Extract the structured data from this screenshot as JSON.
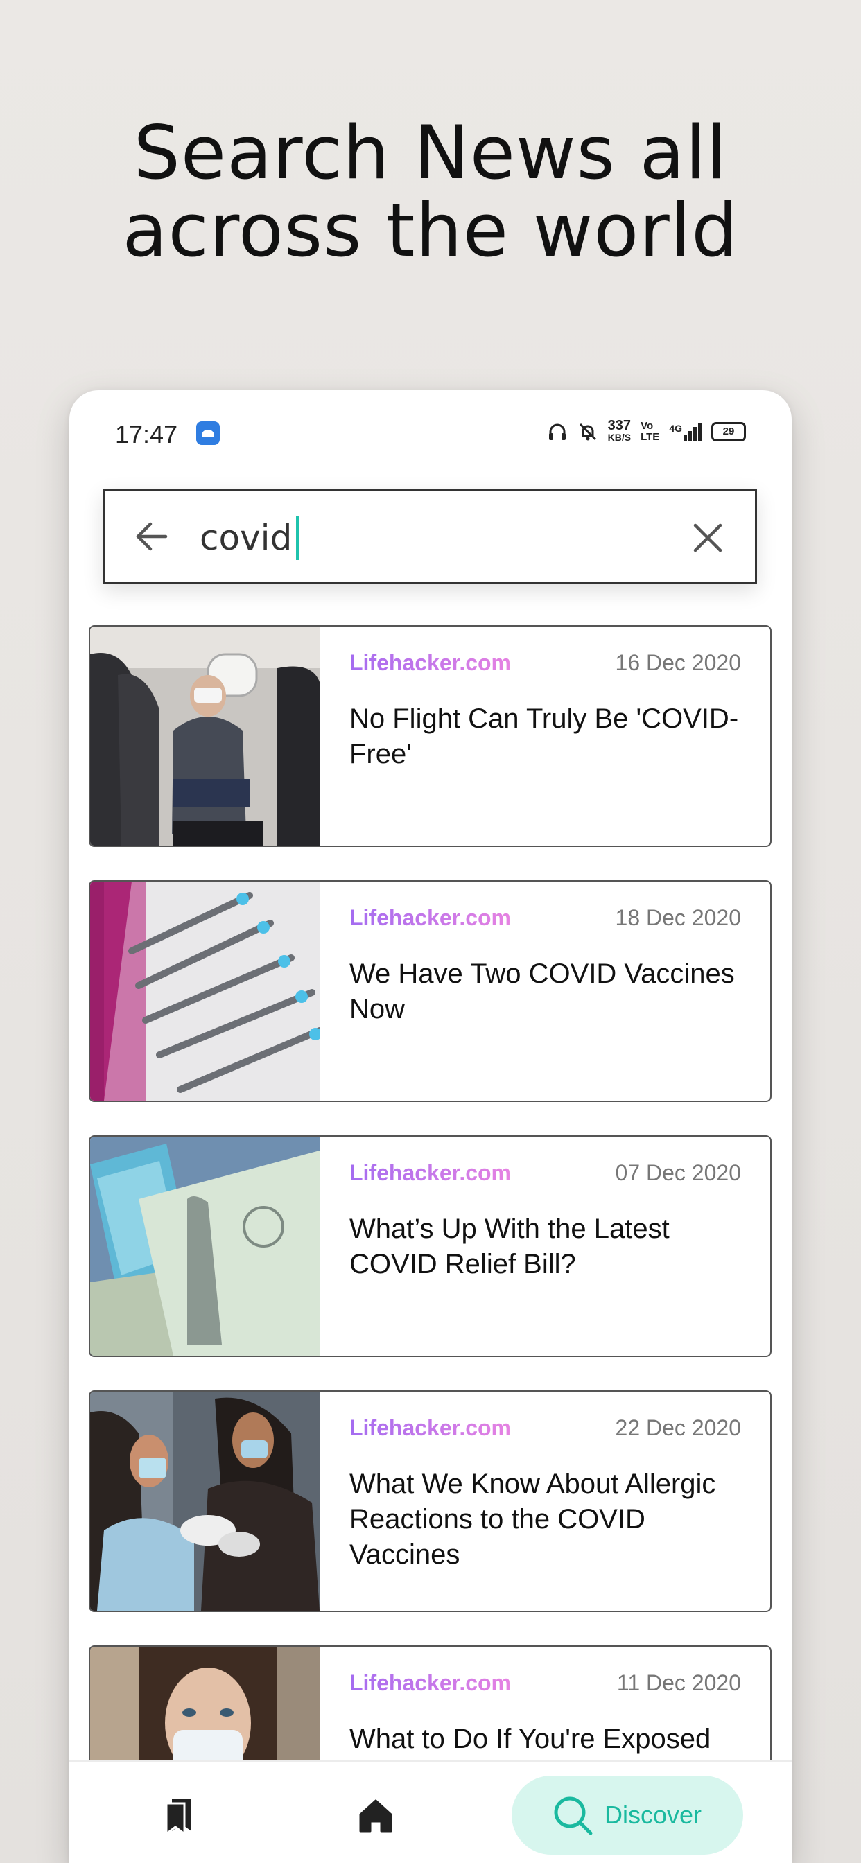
{
  "headline": {
    "line1": "Search News all",
    "line2": "across the world"
  },
  "status_bar": {
    "time": "17:47",
    "speed_value": "337",
    "speed_unit": "KB/S",
    "volte_top": "Vo",
    "volte_bottom": "LTE",
    "network": "4G",
    "battery": "29"
  },
  "search": {
    "value": "covid"
  },
  "articles": [
    {
      "source": "Lifehacker.com",
      "date": "16 Dec 2020",
      "title": "No Flight Can Truly Be 'COVID-Free'"
    },
    {
      "source": "Lifehacker.com",
      "date": "18 Dec 2020",
      "title": "We Have Two COVID Vaccines Now"
    },
    {
      "source": "Lifehacker.com",
      "date": "07 Dec 2020",
      "title": "What’s Up With the Latest COVID Relief Bill?"
    },
    {
      "source": "Lifehacker.com",
      "date": "22 Dec 2020",
      "title": "What We Know About Allergic Reactions to the COVID Vaccines"
    },
    {
      "source": "Lifehacker.com",
      "date": "11 Dec 2020",
      "title": "What to Do If You're Exposed"
    }
  ],
  "bottom_nav": {
    "discover_label": "Discover"
  },
  "colors": {
    "accent": "#1ab99f",
    "discover_bg": "#d7f6ee",
    "source_gradient_start": "#a46cf0",
    "source_gradient_end": "#e682e2"
  },
  "icons": {
    "back": "arrow-left-icon",
    "clear": "close-icon",
    "bookmarks": "bookmarks-icon",
    "home": "home-icon",
    "discover": "search-icon"
  }
}
